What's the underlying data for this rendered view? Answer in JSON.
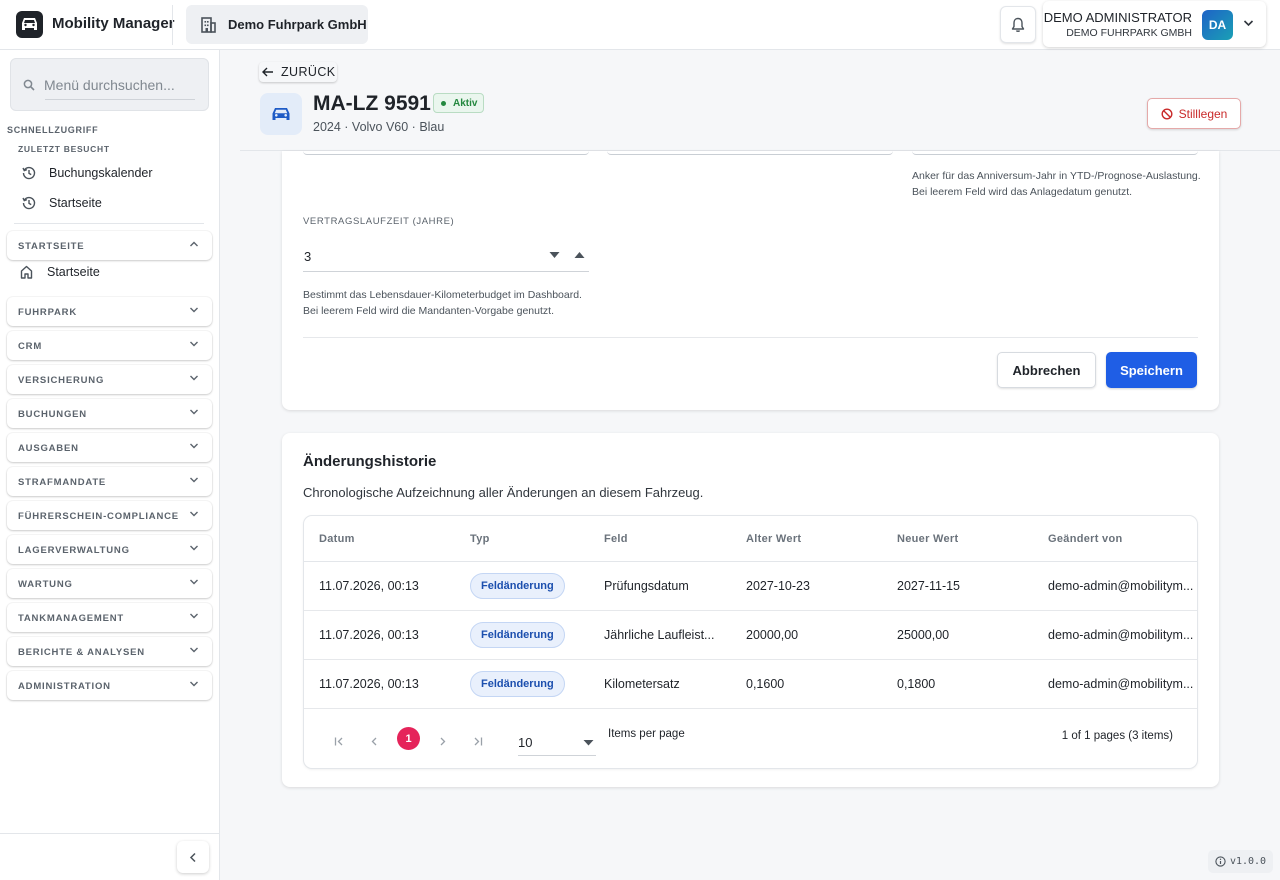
{
  "header": {
    "app_name": "Mobility Manager",
    "tenant_name": "Demo Fuhrpark GmbH",
    "user_name": "DEMO ADMINISTRATOR",
    "user_org": "DEMO FUHRPARK GMBH",
    "user_initials": "DA",
    "icons": [
      "car-logo-icon",
      "building-icon",
      "bell-icon",
      "chevron-down-icon"
    ]
  },
  "sidebar": {
    "search_placeholder": "Menü durchsuchen...",
    "quick_access_label": "SCHNELLZUGRIFF",
    "recent_label": "ZULETZT BESUCHT",
    "recent_items": [
      {
        "label": "Buchungskalender",
        "icon": "history-icon"
      },
      {
        "label": "Startseite",
        "icon": "history-icon"
      }
    ],
    "groups": [
      {
        "label": "STARTSEITE",
        "expanded": true,
        "children": [
          {
            "label": "Startseite",
            "icon": "home-icon"
          }
        ]
      },
      {
        "label": "FUHRPARK",
        "expanded": false
      },
      {
        "label": "CRM",
        "expanded": false
      },
      {
        "label": "VERSICHERUNG",
        "expanded": false
      },
      {
        "label": "BUCHUNGEN",
        "expanded": false
      },
      {
        "label": "AUSGABEN",
        "expanded": false
      },
      {
        "label": "STRAFMANDATE",
        "expanded": false
      },
      {
        "label": "FÜHRERSCHEIN-COMPLIANCE",
        "expanded": false
      },
      {
        "label": "LAGERVERWALTUNG",
        "expanded": false
      },
      {
        "label": "WARTUNG",
        "expanded": false
      },
      {
        "label": "TANKMANAGEMENT",
        "expanded": false
      },
      {
        "label": "BERICHTE & ANALYSEN",
        "expanded": false
      },
      {
        "label": "ADMINISTRATION",
        "expanded": false
      }
    ]
  },
  "page": {
    "back_label": "ZURÜCK",
    "plate": "MA-LZ 9591",
    "status": "Aktiv",
    "status_color": "#24883f",
    "meta": "2024 · Volvo V60 · Blau",
    "decommission_label": "Stilllegen",
    "decommission_color": "#c92a2a"
  },
  "form": {
    "anchor_help": "Anker für das Anniversum-Jahr in YTD-/Prognose-Auslastung. Bei leerem Feld wird das Anlagedatum genutzt.",
    "contract_label": "VERTRAGSLAUFZEIT (JAHRE)",
    "contract_value": "3",
    "contract_help_line1": "Bestimmt das Lebensdauer-Kilometerbudget im Dashboard.",
    "contract_help_line2": "Bei leerem Feld wird die Mandanten-Vorgabe genutzt.",
    "cancel_label": "Abbrechen",
    "save_label": "Speichern",
    "primary_color": "#1f5ee5"
  },
  "history": {
    "title": "Änderungshistorie",
    "subtitle": "Chronologische Aufzeichnung aller Änderungen an diesem Fahrzeug.",
    "columns": [
      "Datum",
      "Typ",
      "Feld",
      "Alter Wert",
      "Neuer Wert",
      "Geändert von"
    ],
    "rows": [
      [
        "11.07.2026, 00:13",
        "Feldänderung",
        "Prüfungsdatum",
        "2027-10-23",
        "2027-11-15",
        "demo-admin@mobilitym..."
      ],
      [
        "11.07.2026, 00:13",
        "Feldänderung",
        "Jährliche Laufleist...",
        "20000,00",
        "25000,00",
        "demo-admin@mobilitym..."
      ],
      [
        "11.07.2026, 00:13",
        "Feldänderung",
        "Kilometersatz",
        "0,1600",
        "0,1800",
        "demo-admin@mobilitym..."
      ]
    ],
    "pager": {
      "current_page": "1",
      "page_size": "10",
      "page_size_label": "Items per page",
      "info": "1 of 1 pages (3 items)",
      "accent_color": "#e5245a"
    }
  },
  "footer": {
    "version": "v1.0.0"
  }
}
